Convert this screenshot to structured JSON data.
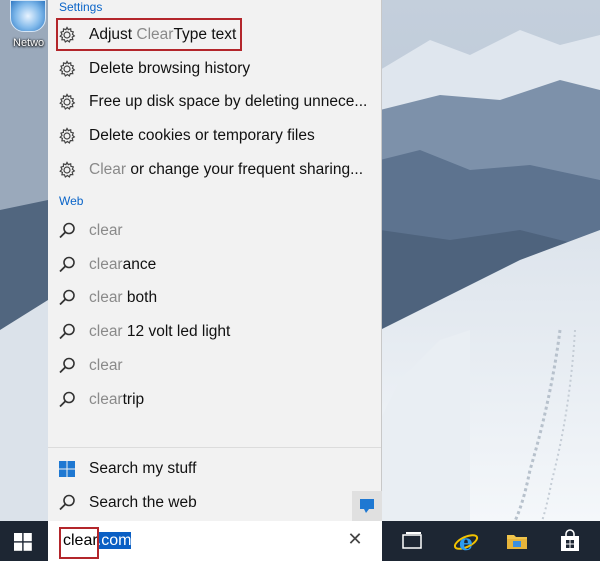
{
  "desktop": {
    "icon_label": "Netwo"
  },
  "settings": {
    "title": "Settings",
    "items": [
      {
        "parts": [
          {
            "text": "Adjust ",
            "hl": false
          },
          {
            "text": "Clear",
            "hl": true
          },
          {
            "text": "Type text",
            "hl": false
          }
        ]
      },
      {
        "parts": [
          {
            "text": "Delete browsing history",
            "hl": false
          }
        ]
      },
      {
        "parts": [
          {
            "text": "Free up disk space by deleting unnece...",
            "hl": false
          }
        ]
      },
      {
        "parts": [
          {
            "text": "Delete cookies or temporary files",
            "hl": false
          }
        ]
      },
      {
        "parts": [
          {
            "text": "Clear",
            "hl": true
          },
          {
            "text": " or change your frequent sharing...",
            "hl": false
          }
        ]
      }
    ]
  },
  "web": {
    "title": "Web",
    "items": [
      {
        "parts": [
          {
            "text": "clear",
            "hl": true
          }
        ]
      },
      {
        "parts": [
          {
            "text": "clear",
            "hl": true
          },
          {
            "text": "ance",
            "hl": false
          }
        ]
      },
      {
        "parts": [
          {
            "text": "clear",
            "hl": true
          },
          {
            "text": " both",
            "hl": false
          }
        ]
      },
      {
        "parts": [
          {
            "text": "clear",
            "hl": true
          },
          {
            "text": " 12 volt led light",
            "hl": false
          }
        ]
      },
      {
        "parts": [
          {
            "text": "clear",
            "hl": true
          }
        ]
      },
      {
        "parts": [
          {
            "text": "clear",
            "hl": true
          },
          {
            "text": "trip",
            "hl": false
          }
        ]
      }
    ]
  },
  "footer": {
    "search_my_stuff": "Search my stuff",
    "search_the_web": "Search the web"
  },
  "search_box": {
    "typed": "clear",
    "autocomplete": ".com",
    "clear_glyph": "✕"
  },
  "colors": {
    "accent": "#0a64c8",
    "highlight_box": "#b3262b",
    "taskbar": "#1d2633",
    "panel": "#f2f2f2"
  },
  "icons": {
    "settings_item": "gear-icon",
    "web_item": "search-icon",
    "search_my_stuff": "windows-logo-icon",
    "search_the_web": "search-icon",
    "feedback": "feedback-icon",
    "start": "windows-logo-icon",
    "task_view": "task-view-icon",
    "browser": "internet-explorer-icon",
    "files": "file-explorer-icon",
    "store": "store-icon"
  }
}
